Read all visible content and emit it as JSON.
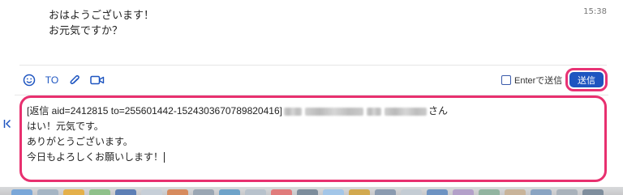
{
  "message": {
    "line1": "おはようございます！",
    "line2": "お元気ですか？",
    "time": "15:38"
  },
  "toolbar": {
    "emoji_icon": "emoji-icon",
    "to_label": "TO",
    "attach_icon": "paperclip-icon",
    "video_icon": "video-icon",
    "enter_label": "Enterで送信",
    "enter_checked": false,
    "send_label": "送信",
    "accent": "#1e55c0",
    "highlight": "#e8306f"
  },
  "compose": {
    "reply_prefix": "[返信 aid=2412815 to=255601442-1524303670789820416]",
    "name_suffix": "さん",
    "line2": "はい！元気です。",
    "line3": "ありがとうございます。",
    "line4": "今日もよろしくお願いします！"
  },
  "side": {
    "collapse_icon": "collapse-left-icon"
  }
}
